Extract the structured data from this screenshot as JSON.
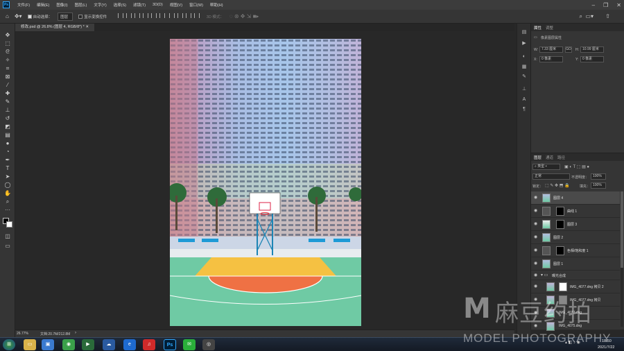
{
  "menu": {
    "items": [
      "文件(F)",
      "编辑(E)",
      "图像(I)",
      "图层(L)",
      "文字(Y)",
      "选择(S)",
      "滤镜(T)",
      "3D(D)",
      "视图(V)",
      "窗口(W)",
      "帮助(H)"
    ]
  },
  "options": {
    "auto_select_label": "自动选择：",
    "auto_select_value": "图层",
    "transform_label": "显示变换控件",
    "mode_3d_label": "3D 模式："
  },
  "document": {
    "tab_title": "修改.psd @ 26.8% (图层 4, RGB/8*) *",
    "zoom": "26.77%",
    "doc_size": "文档:20.7M/212.8M"
  },
  "properties": {
    "tab_properties": "属性",
    "tab_adjustments": "调整",
    "section": "像素图层属性",
    "w_label": "W:",
    "w_value": "7.33 厘米",
    "link_label": "GO",
    "h_label": "H:",
    "h_value": "10.99 厘米",
    "x_label": "X:",
    "x_value": "0 像素",
    "y_label": "Y:",
    "y_value": "0 像素"
  },
  "layers": {
    "tabs": [
      "图层",
      "通道",
      "路径"
    ],
    "kind_filter": "类型",
    "blend_mode": "正常",
    "opacity_label": "不透明度：",
    "opacity_value": "100%",
    "lock_label": "锁定：",
    "fill_label": "填充：",
    "fill_value": "100%",
    "items": [
      {
        "name": "图层 4",
        "selected": true,
        "mask": false
      },
      {
        "name": "曲线 1",
        "selected": false,
        "mask": true
      },
      {
        "name": "图层 3",
        "selected": false,
        "mask": true
      },
      {
        "name": "图层 2",
        "selected": false,
        "mask": false
      },
      {
        "name": "色相/饱和度 1",
        "selected": false,
        "mask": true
      },
      {
        "name": "图层 1",
        "selected": false,
        "mask": false
      },
      {
        "name": "曝光合成",
        "selected": false,
        "mask": false
      },
      {
        "name": "IMG_4077.dng 拷贝 2",
        "selected": false,
        "mask": true
      },
      {
        "name": "IMG_4077.dng 拷贝",
        "selected": false,
        "mask": true
      },
      {
        "name": "IMG_4077.dng",
        "selected": false,
        "mask": false
      },
      {
        "name": "IMG_4075.dng",
        "selected": false,
        "mask": false
      }
    ]
  },
  "taskbar": {
    "time": "18:50",
    "date": "2021/7/22"
  },
  "watermark": {
    "logo_text": "麻豆约拍",
    "sub_text": "MODEL PHOTOGRAPHY"
  }
}
